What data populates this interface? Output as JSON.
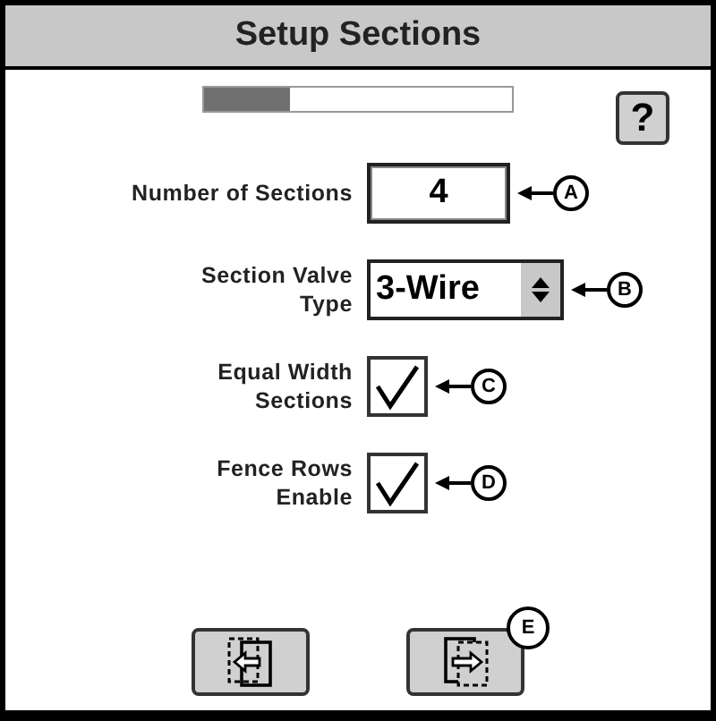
{
  "window": {
    "title": "Setup Sections"
  },
  "progress": {
    "level": 0.28
  },
  "help_button": {
    "label": "?"
  },
  "settings": [
    {
      "kind": "number",
      "label": "Number of Sections",
      "value": "4",
      "callout": "A"
    },
    {
      "kind": "select",
      "label": "Section Valve Type",
      "value": "3-Wire",
      "callout": "B"
    },
    {
      "kind": "checkbox",
      "label": "Equal Width Sections",
      "checked": true,
      "callout": "C"
    },
    {
      "kind": "checkbox",
      "label": "Fence Rows Enable",
      "checked": true,
      "callout": "D"
    }
  ],
  "nav_buttons": [
    {
      "kind": "back"
    },
    {
      "kind": "next",
      "callout": "E"
    }
  ]
}
